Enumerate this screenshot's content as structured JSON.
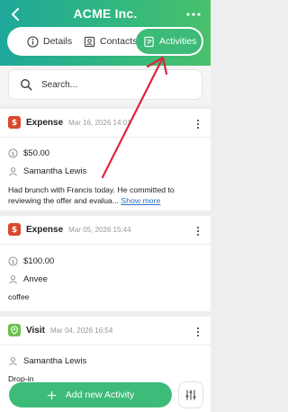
{
  "header": {
    "title": "ACME Inc.",
    "tabs": [
      {
        "label": "Details",
        "icon": "info-icon"
      },
      {
        "label": "Contacts",
        "icon": "contact-card-icon"
      },
      {
        "label": "Activities",
        "icon": "activity-note-icon",
        "active": true
      }
    ]
  },
  "search": {
    "placeholder": "Search..."
  },
  "activities": [
    {
      "type": "Expense",
      "date": "Mar 16, 2026 14:01",
      "amount": "$50.00",
      "person": "Samantha Lewis",
      "note": "Had brunch with Francis today. He committed to reviewing the offer and evalua...",
      "show_more": "Show more"
    },
    {
      "type": "Expense",
      "date": "Mar 05, 2026 15:44",
      "amount": "$100.00",
      "person": "Anvee",
      "note": "coffee"
    },
    {
      "type": "Visit",
      "date": "Mar 04, 2026 16:54",
      "person": "Samantha Lewis",
      "note": "Drop-in"
    }
  ],
  "bottom": {
    "add_label": "Add new Activity"
  },
  "colors": {
    "accent": "#3dbb78",
    "expense": "#d9482b",
    "visit": "#6cc04a",
    "annotation": "#e0243a"
  }
}
